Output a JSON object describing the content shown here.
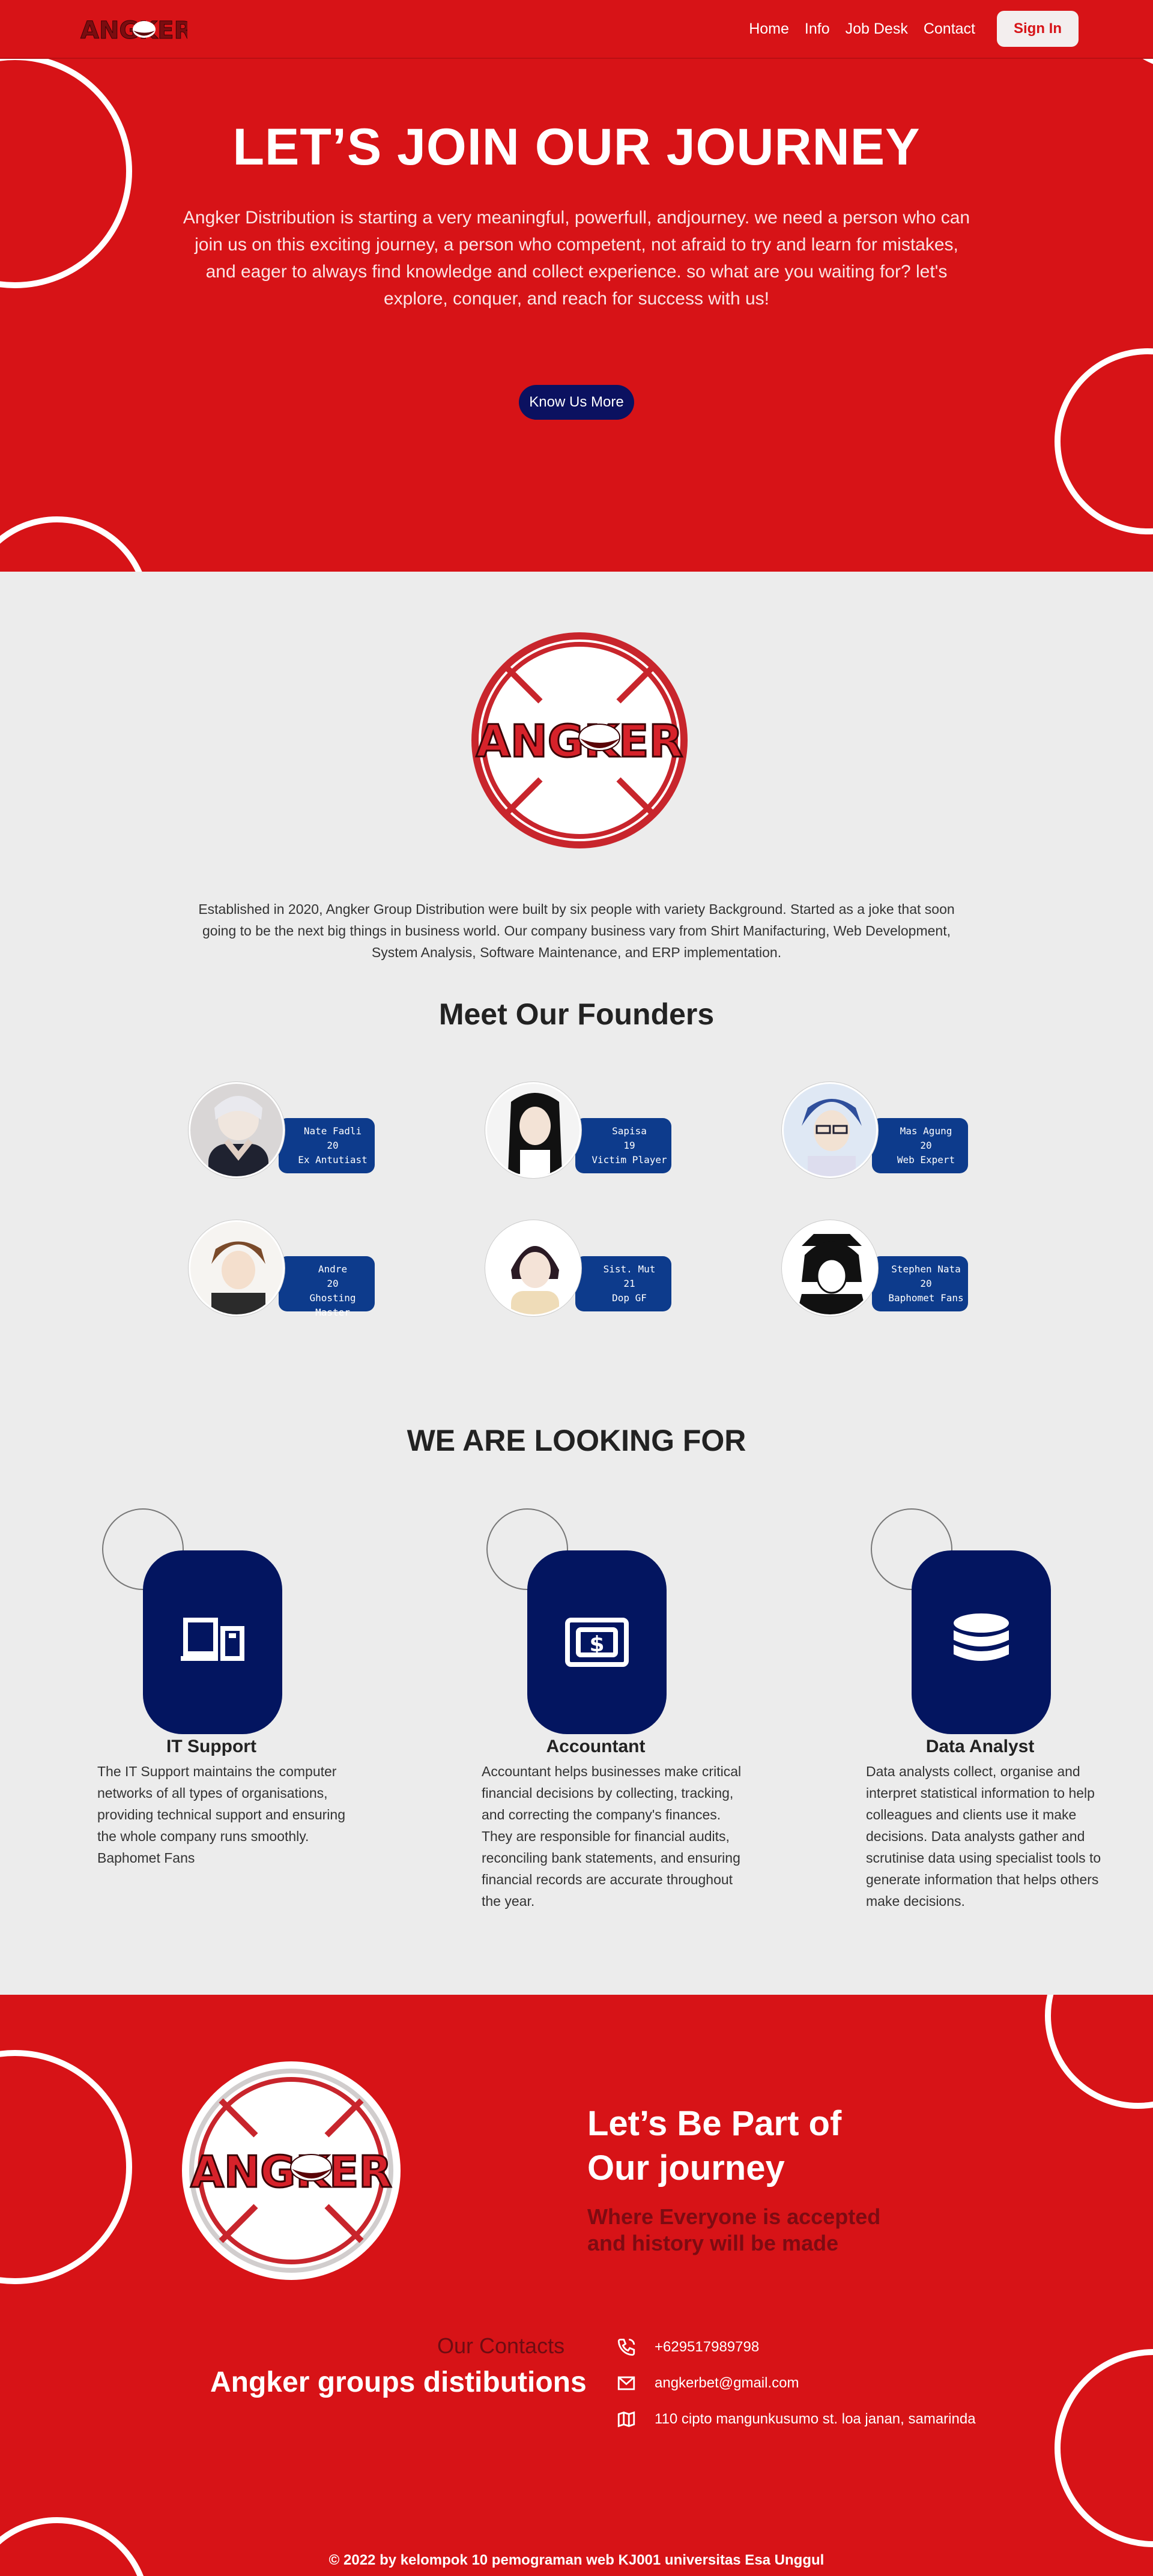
{
  "nav": {
    "logo_text": "ANGKER",
    "menu": [
      "Home",
      "Info",
      "Job Desk",
      "Contact"
    ],
    "signin": "Sign In"
  },
  "hero": {
    "title": "LET’S JOIN OUR JOURNEY",
    "text": "Angker Distribution is starting a very meaningful, powerfull, andjourney. we need a person who can join us on this exciting journey, a person who competent, not afraid to try and learn for mistakes, and eager to always find knowledge and collect experience. so what are you waiting for? let's explore, conquer, and reach for success with us!",
    "button": "Know Us More"
  },
  "about": {
    "text": "Established in 2020, Angker Group Distribution were built by six people with variety Background. Started as a joke that soon going to be the next big things in business world. Our company business vary from Shirt Manifacturing, Web Development, System Analysis, Software Maintenance, and ERP implementation."
  },
  "founders": {
    "heading": "Meet Our Founders",
    "people": [
      {
        "name": "Nate Fadli",
        "age": "20",
        "role": "Ex Antutiast"
      },
      {
        "name": "Sapisa",
        "age": "19",
        "role": "Victim Player"
      },
      {
        "name": "Mas Agung",
        "age": "20",
        "role": "Web Expert"
      },
      {
        "name": "Andre",
        "age": "20",
        "role": "Ghosting Master"
      },
      {
        "name": "Sist. Mut",
        "age": "21",
        "role": "Dop GF"
      },
      {
        "name": "Stephen Nata",
        "age": "20",
        "role": "Baphomet Fans"
      }
    ]
  },
  "jobs": {
    "heading": "WE ARE LOOKING FOR",
    "items": [
      {
        "title": "IT Support",
        "icon": "devices-icon",
        "desc": "The IT Support maintains the computer networks of all types of organisations, providing technical support and ensuring the whole company runs smoothly. Baphomet Fans"
      },
      {
        "title": "Accountant",
        "icon": "cash-icon",
        "desc": "Accountant helps businesses make critical financial decisions by collecting, tracking, and correcting the company's finances. They are responsible for financial audits, reconciling bank statements, and ensuring financial records are accurate throughout the year."
      },
      {
        "title": "Data Analyst",
        "icon": "database-icon",
        "desc": "Data analysts collect, organise and interpret statistical information to help colleagues and clients use it make decisions. Data analysts gather and scrutinise data using specialist tools to generate information that helps others make decisions."
      }
    ]
  },
  "footer": {
    "cta_line1": "Let’s Be Part of",
    "cta_line2": "Our journey",
    "sub_line1": "Where Everyone is accepted",
    "sub_line2": "and history will be made",
    "our_contacts": "Our Contacts",
    "company": "Angker groups distibutions",
    "phone": "+629517989798",
    "email": "angkerbet@gmail.com",
    "address": "110 cipto mangunkusumo st. loa janan, samarinda",
    "copyright": "© 2022 by kelompok 10 pemograman web KJ001 universitas Esa Unggul"
  },
  "colors": {
    "primary": "#d71317",
    "navy": "#031560",
    "card": "#0d3b8c"
  }
}
